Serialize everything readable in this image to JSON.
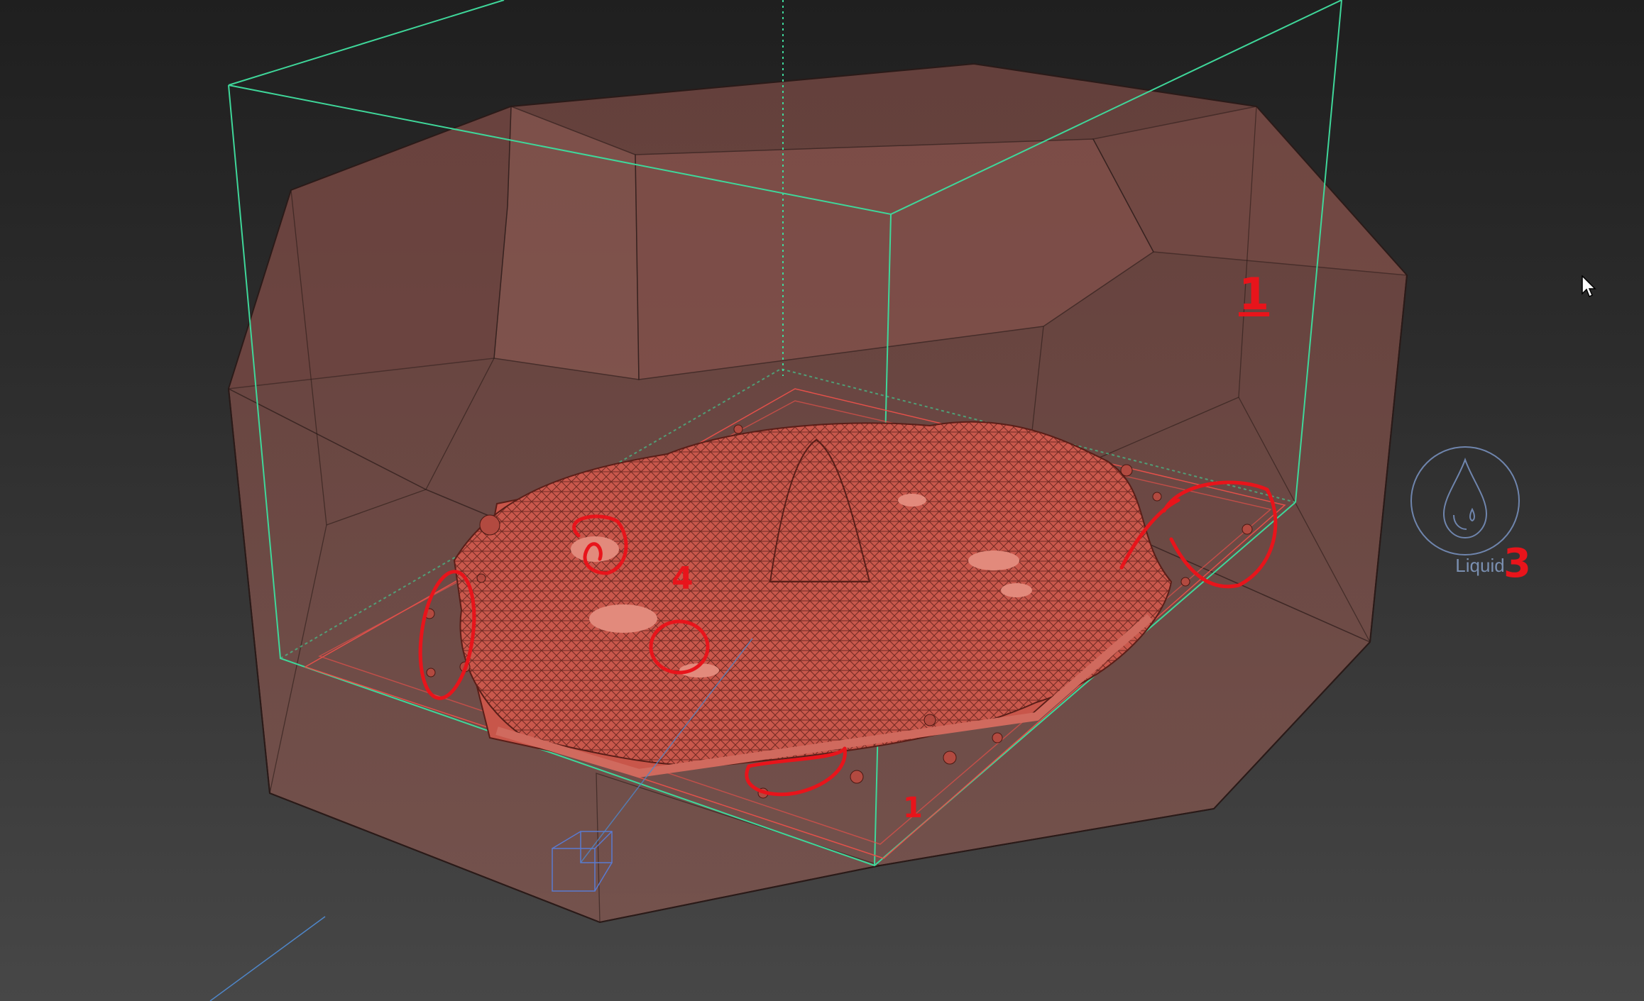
{
  "viewport": {
    "background_top": "#1f1f1f",
    "background_bottom": "#474747"
  },
  "colors": {
    "volume_fill": "#a65a50",
    "volume_edge": "#2a1a18",
    "bbox": "#3fd79a",
    "liquid_mesh": "#d96a5e",
    "annotation": "#e8141b",
    "icon": "#6f85ad"
  },
  "liquid_icon": {
    "icon": "water-drop-icon",
    "label": "Liquid"
  },
  "annotations": {
    "a1_top": "1",
    "a1_bottom": "1",
    "a3": "3",
    "a4": "4"
  },
  "emitter_icon": "cube-emitter-icon",
  "cursor_icon": "arrow-cursor-icon"
}
